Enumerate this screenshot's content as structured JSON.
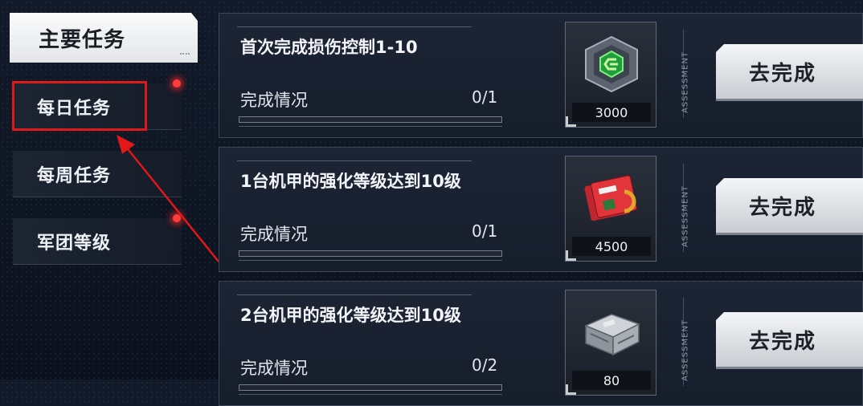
{
  "sidebar": {
    "main_tab": "主要任务",
    "items": [
      {
        "label": "每日任务",
        "has_alert": true,
        "highlighted": true
      },
      {
        "label": "每周任务",
        "has_alert": false,
        "highlighted": false
      },
      {
        "label": "军团等级",
        "has_alert": true,
        "highlighted": false
      }
    ]
  },
  "tasks": [
    {
      "title": "首次完成损伤控制1-10",
      "progress_label": "完成情况",
      "progress": "0/1",
      "progress_fraction": 0,
      "reward_icon": "green-hexagon-chip-icon",
      "reward_amount": "3000",
      "side_label": "ASSESSMENT",
      "button": "去完成"
    },
    {
      "title": "1台机甲的强化等级达到10级",
      "progress_label": "完成情况",
      "progress": "0/1",
      "progress_fraction": 0,
      "reward_icon": "data-chip-icon",
      "reward_amount": "4500",
      "side_label": "ASSESSMENT",
      "button": "去完成"
    },
    {
      "title": "2台机甲的强化等级达到10级",
      "progress_label": "完成情况",
      "progress": "0/2",
      "progress_fraction": 0,
      "reward_icon": "metal-crate-icon",
      "reward_amount": "80",
      "side_label": "ASSESSMENT",
      "button": "去完成"
    }
  ],
  "colors": {
    "alert_dot": "#ff3b3b",
    "highlight_box": "#e01818",
    "background": "#0d1320"
  }
}
